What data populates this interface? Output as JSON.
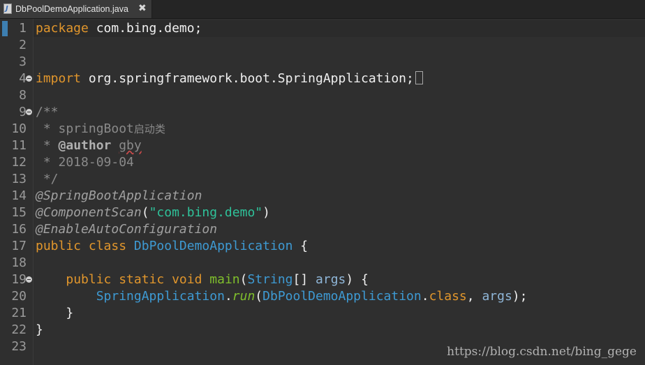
{
  "tab": {
    "title": "DbPoolDemoApplication.java",
    "icon": "java-file-icon",
    "close_glyph": "✖"
  },
  "editor": {
    "line_numbers": [
      "1",
      "2",
      "3",
      "4",
      "8",
      "9",
      "10",
      "11",
      "12",
      "13",
      "14",
      "15",
      "16",
      "17",
      "18",
      "19",
      "20",
      "21",
      "22",
      "23"
    ],
    "code": {
      "l1_kw": "package",
      "l1_rest": " com.bing.demo;",
      "l4_kw": "import",
      "l4_rest": " org.springframework.boot.SpringApplication;",
      "l9": "/**",
      "l10_a": " * springBoot",
      "l10_b": "启动类",
      "l11_a": " * ",
      "l11_tag": "@author",
      "l11_sp": " ",
      "l11_name": "gby",
      "l12": " * 2018-09-04",
      "l13": " */",
      "l14": "@SpringBootApplication",
      "l15_ann": "@ComponentScan",
      "l15_open": "(",
      "l15_str": "\"com.bing.demo\"",
      "l15_close": ")",
      "l16": "@EnableAutoConfiguration",
      "l17_kw": "public class",
      "l17_sp": " ",
      "l17_type": "DbPoolDemoApplication",
      "l17_rest": " {",
      "l19_ind": "    ",
      "l19_kw": "public static void",
      "l19_sp": " ",
      "l19_meth": "main",
      "l19_p1": "(",
      "l19_type": "String",
      "l19_arr": "[] ",
      "l19_param": "args",
      "l19_end": ") {",
      "l20_ind": "        ",
      "l20_type": "SpringApplication",
      "l20_dot": ".",
      "l20_meth": "run",
      "l20_p1": "(",
      "l20_type2": "DbPoolDemoApplication",
      "l20_dot2": ".",
      "l20_kw": "class",
      "l20_comma": ", ",
      "l20_param": "args",
      "l20_end": ");",
      "l21": "    }",
      "l22": "}"
    }
  },
  "watermark": "https://blog.csdn.net/bing_gege"
}
